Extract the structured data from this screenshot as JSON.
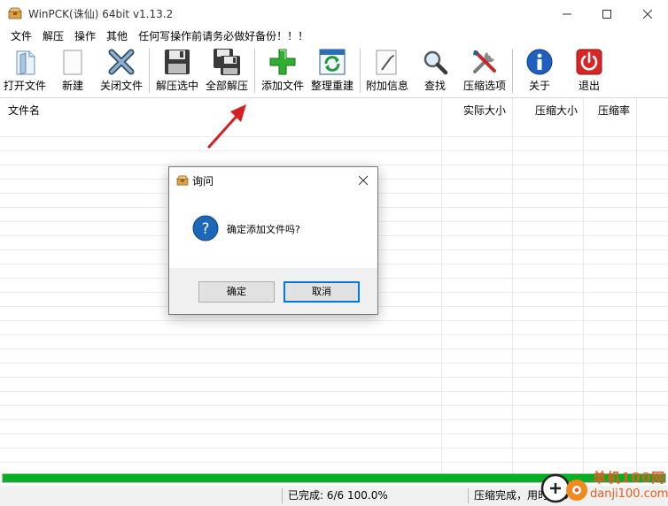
{
  "window": {
    "title": "WinPCK(诛仙) 64bit v1.13.2"
  },
  "menu": {
    "items": [
      "文件",
      "解压",
      "操作",
      "其他",
      "任何写操作前请务必做好备份！！！"
    ]
  },
  "toolbar": {
    "buttons": [
      {
        "label": "打开文件",
        "icon": "open-file-icon"
      },
      {
        "label": "新建",
        "icon": "new-file-icon"
      },
      {
        "label": "关闭文件",
        "icon": "close-file-icon"
      },
      {
        "label": "解压选中",
        "icon": "extract-selected-icon"
      },
      {
        "label": "全部解压",
        "icon": "extract-all-icon"
      },
      {
        "label": "添加文件",
        "icon": "add-file-icon"
      },
      {
        "label": "整理重建",
        "icon": "rebuild-icon"
      },
      {
        "label": "附加信息",
        "icon": "info-icon"
      },
      {
        "label": "查找",
        "icon": "search-icon"
      },
      {
        "label": "压缩选项",
        "icon": "tools-icon"
      },
      {
        "label": "关于",
        "icon": "about-icon"
      },
      {
        "label": "退出",
        "icon": "exit-icon"
      }
    ]
  },
  "list": {
    "columns": [
      "文件名",
      "实际大小",
      "压缩大小",
      "压缩率"
    ]
  },
  "progress": {
    "value": 1.0,
    "color": "#06b025"
  },
  "status": {
    "completed": "已完成: 6/6 100.0%",
    "message": "压缩完成，用时 2.0"
  },
  "dialog": {
    "title": "询问",
    "message": "确定添加文件吗?",
    "ok_label": "确定",
    "cancel_label": "取消"
  },
  "watermark": {
    "line1": "单机100网",
    "line2": "danji100.com"
  },
  "colors": {
    "accent": "#0078d7",
    "annotation_arrow": "#d42020",
    "watermark": "#e85a20"
  }
}
